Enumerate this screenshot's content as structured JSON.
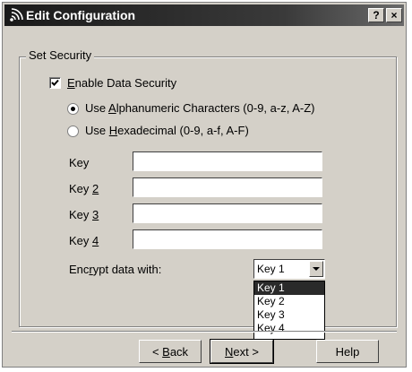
{
  "window": {
    "title": "Edit Configuration",
    "help_btn": "?",
    "close_btn": "×"
  },
  "group": {
    "label": "Set Security"
  },
  "enable_security": {
    "label_underline": "E",
    "label_rest": "nable Data Security",
    "checked": true
  },
  "radios": [
    {
      "pre": "Use ",
      "underline": "A",
      "rest": "lphanumeric Characters (0-9, a-z, A-Z)",
      "selected": true
    },
    {
      "pre": "Use ",
      "underline": "H",
      "rest": "exadecimal (0-9, a-f, A-F)",
      "selected": false
    }
  ],
  "keys": [
    {
      "label_pre": "Key",
      "label_underline": "",
      "value": ""
    },
    {
      "label_pre": "Key ",
      "label_underline": "2",
      "value": ""
    },
    {
      "label_pre": "Key ",
      "label_underline": "3",
      "value": ""
    },
    {
      "label_pre": "Key ",
      "label_underline": "4",
      "value": ""
    }
  ],
  "encrypt": {
    "label_pre": "Enc",
    "label_underline": "r",
    "label_rest": "ypt data with:",
    "selected": "Key 1",
    "options": [
      "Key 1",
      "Key 2",
      "Key 3",
      "Key 4"
    ]
  },
  "buttons": {
    "back_pre": "< ",
    "back_underline": "B",
    "back_rest": "ack",
    "next_underline": "N",
    "next_rest": "ext >",
    "help": "Help"
  }
}
